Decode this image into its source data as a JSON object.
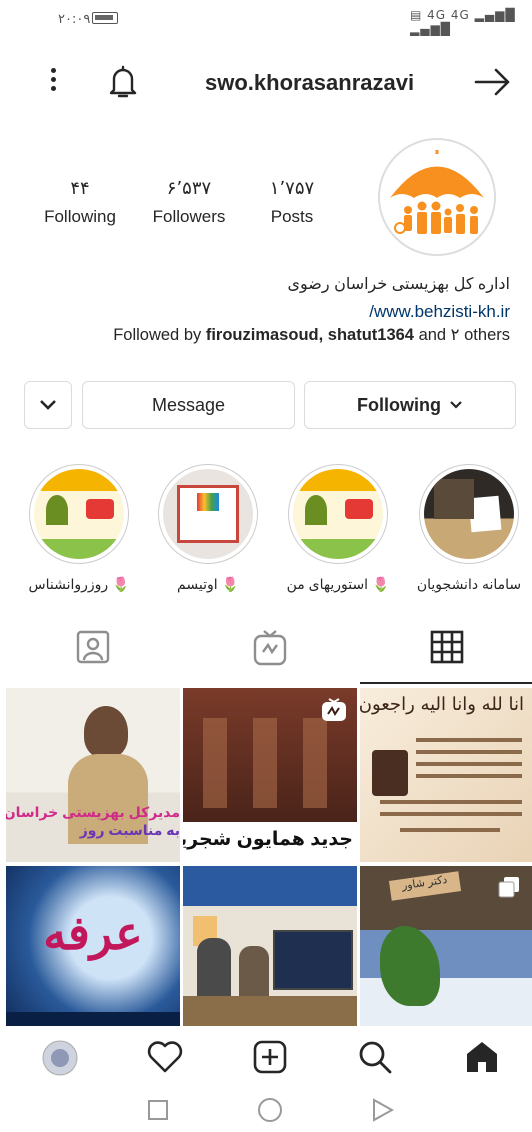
{
  "status_bar": {
    "time": "۲۰:۰۹",
    "network": "4G 4G"
  },
  "header": {
    "username": "swo.khorasanrazavi"
  },
  "stats": [
    {
      "value": "۱٬۷۵۷",
      "label": "Posts"
    },
    {
      "value": "۶٬۵۳۷",
      "label": "Followers"
    },
    {
      "value": "۴۴",
      "label": "Following"
    }
  ],
  "bio": {
    "name": "اداره کل بهزیستی خراسان رضوی",
    "link": "/www.behzisti-kh.ir",
    "followed_by_prefix": "Followed by ",
    "followed_by_users": "firouzimasoud, shatut1364",
    "followed_by_suffix": " and ۲ others"
  },
  "buttons": {
    "following": "Following",
    "message": "Message"
  },
  "highlights": [
    {
      "caption": "سامانه دانشجویان"
    },
    {
      "caption": "🌷 استوریهای من"
    },
    {
      "caption": "🌷 اوتیسم"
    },
    {
      "caption": "🌷 روزروانشناس"
    }
  ],
  "grid": {
    "post1_text": "مدیرکل بهزیستی خراسان",
    "post1_text2": "به مناسبت روز",
    "post2_text": "جدید همایون شجریان",
    "post3_text": "انا لله وانا الیه راجعون",
    "post4_text": "عرفه",
    "post6_text": "دکتر شاور"
  },
  "colors": {
    "brand_orange": "#f7901e",
    "text": "#262626",
    "link": "#00376b"
  }
}
